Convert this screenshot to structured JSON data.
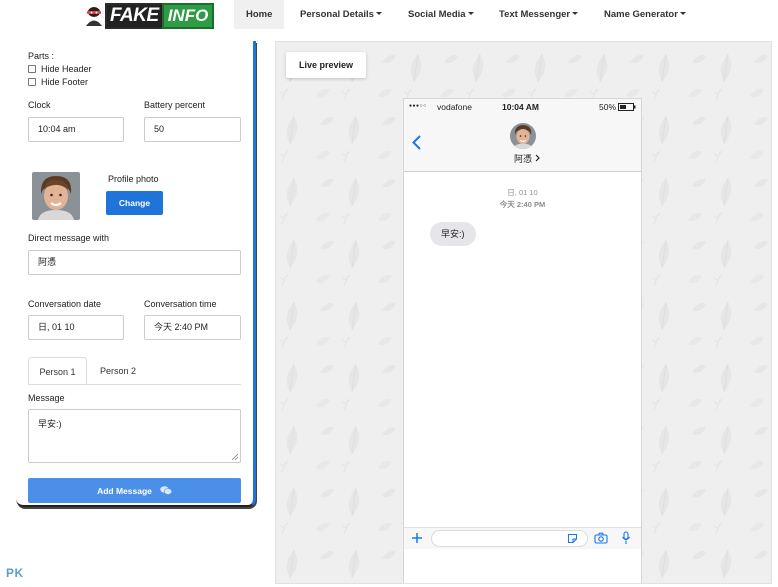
{
  "nav": {
    "logo": "FAKEINFO",
    "items": [
      {
        "label": "Home",
        "caret": false,
        "active": true
      },
      {
        "label": "Personal Details",
        "caret": true,
        "active": false
      },
      {
        "label": "Social Media",
        "caret": true,
        "active": false
      },
      {
        "label": "Text Messenger",
        "caret": true,
        "active": false
      },
      {
        "label": "Name Generator",
        "caret": true,
        "active": false
      }
    ]
  },
  "form": {
    "parts_label": "Parts :",
    "hide_header": "Hide Header",
    "hide_footer": "Hide Footer",
    "clock_label": "Clock",
    "clock_value": "10:04 am",
    "battery_label": "Battery percent",
    "battery_value": "50",
    "profile_photo_label": "Profile photo",
    "change_button": "Change",
    "dm_label": "Direct message with",
    "dm_value": "阿憑",
    "conv_date_label": "Conversation date",
    "conv_date_value": "日, 01 10",
    "conv_time_label": "Conversation time",
    "conv_time_value": "今天 2:40 PM",
    "tabs": [
      "Person 1",
      "Person 2"
    ],
    "message_label": "Message",
    "message_value": "早安:)",
    "add_button": "Add Message"
  },
  "preview": {
    "live_button": "Live preview",
    "status": {
      "carrier": "vodafone",
      "time": "10:04 AM",
      "battery": "50%"
    },
    "contact_name": "阿憑",
    "date_line": "日, 01 10",
    "time_line": "今天 2:40 PM",
    "bubble_text": "早安:)"
  },
  "watermark": "PK",
  "colors": {
    "primary": "#1e74d9",
    "add_button": "#4b8fe8",
    "ios_blue": "#1a7ae6",
    "bubble": "#e5e5ea"
  }
}
